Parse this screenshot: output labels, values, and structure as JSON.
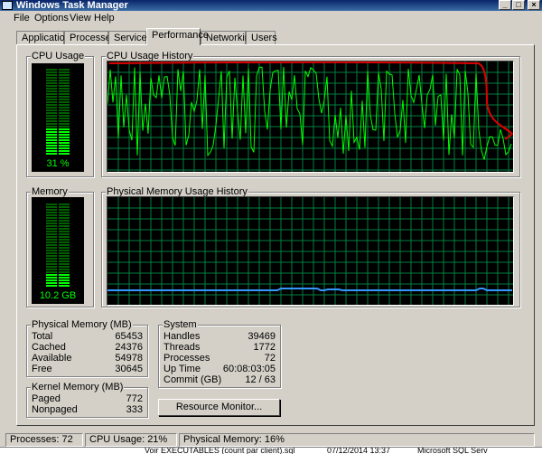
{
  "window": {
    "title": "Windows Task Manager"
  },
  "menu": [
    "File",
    "Options",
    "View",
    "Help"
  ],
  "tabs": [
    "Applications",
    "Processes",
    "Services",
    "Performance",
    "Networking",
    "Users"
  ],
  "active_tab": "Performance",
  "cpu": {
    "group_label": "CPU Usage",
    "value": "31 %",
    "level": 0.31,
    "history_label": "CPU Usage History",
    "color": "#00ff00"
  },
  "memory": {
    "group_label": "Memory",
    "value": "10.2 GB",
    "level": 0.16,
    "history_label": "Physical Memory Usage History",
    "color": "#00ff00",
    "history_color": "#3399ff"
  },
  "physical_memory": {
    "label": "Physical Memory (MB)",
    "rows": [
      {
        "name": "Total",
        "value": "65453"
      },
      {
        "name": "Cached",
        "value": "24376"
      },
      {
        "name": "Available",
        "value": "54978"
      },
      {
        "name": "Free",
        "value": "30645"
      }
    ]
  },
  "kernel_memory": {
    "label": "Kernel Memory (MB)",
    "rows": [
      {
        "name": "Paged",
        "value": "772"
      },
      {
        "name": "Nonpaged",
        "value": "333"
      }
    ]
  },
  "system": {
    "label": "System",
    "rows": [
      {
        "name": "Handles",
        "value": "39469"
      },
      {
        "name": "Threads",
        "value": "1772"
      },
      {
        "name": "Processes",
        "value": "72"
      },
      {
        "name": "Up Time",
        "value": "60:08:03:05"
      },
      {
        "name": "Commit (GB)",
        "value": "12 / 63"
      }
    ]
  },
  "resource_monitor_button": "Resource Monitor...",
  "status": {
    "processes": "Processes: 72",
    "cpu": "CPU Usage: 21%",
    "memory": "Physical Memory: 16%"
  },
  "background_window": {
    "item": "Voir EXECUTABLES (count par client).sql",
    "date": "07/12/2014 13:37",
    "app": "Microsoft SQL Serv"
  },
  "annotation_color": "#e00000"
}
